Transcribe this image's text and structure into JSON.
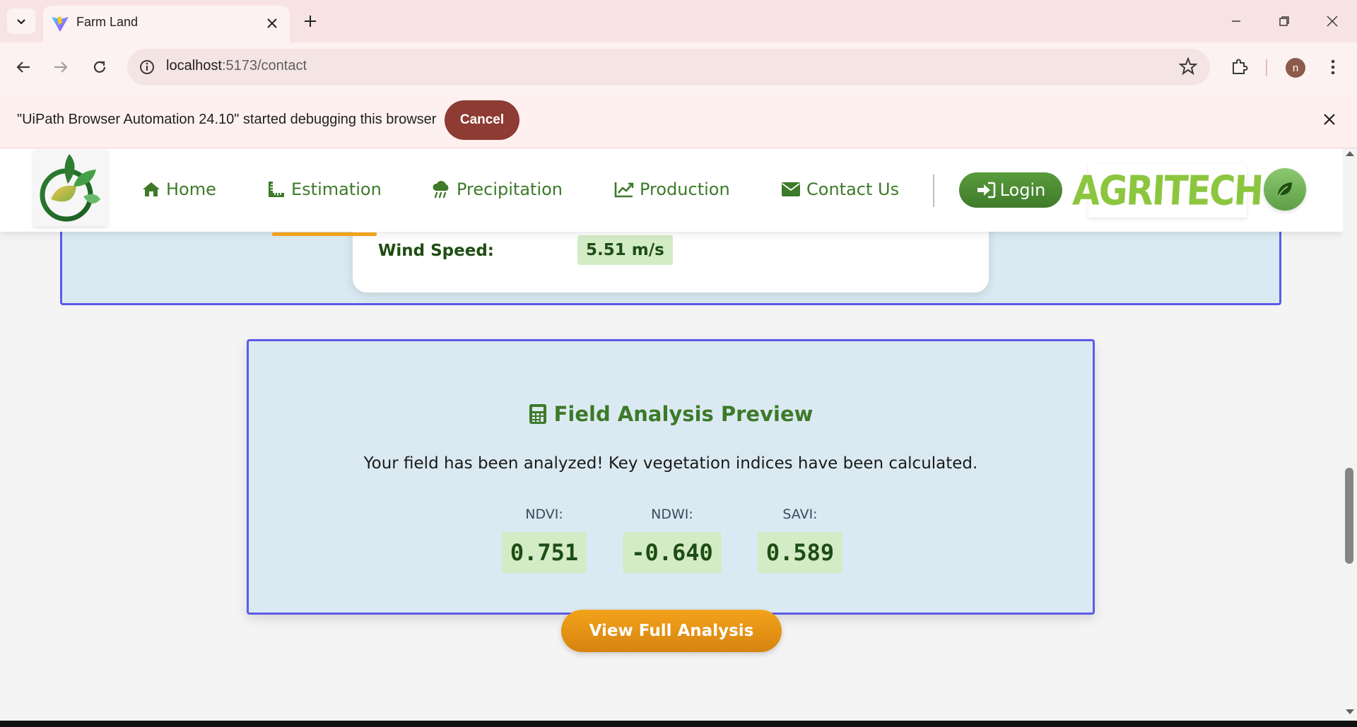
{
  "browser": {
    "tab_title": "Farm Land",
    "url_host": "localhost",
    "url_path": ":5173/contact",
    "profile_initial": "n"
  },
  "infobar": {
    "message": "\"UiPath Browser Automation 24.10\" started debugging this browser",
    "cancel_label": "Cancel"
  },
  "navbar": {
    "items": [
      {
        "label": "Home",
        "icon": "home-icon"
      },
      {
        "label": "Estimation",
        "icon": "ruler-icon"
      },
      {
        "label": "Precipitation",
        "icon": "cloud-rain-icon"
      },
      {
        "label": "Production",
        "icon": "chart-line-icon"
      },
      {
        "label": "Contact Us",
        "icon": "envelope-icon"
      }
    ],
    "login_label": "Login",
    "brand": "AGRITECH"
  },
  "weather": {
    "wind_label": "Wind Speed:",
    "wind_value": "5.51 m/s"
  },
  "analysis": {
    "title": "Field Analysis Preview",
    "description": "Your field has been analyzed! Key vegetation indices have been calculated.",
    "indices": [
      {
        "label": "NDVI:",
        "value": "0.751"
      },
      {
        "label": "NDWI:",
        "value": "-0.640"
      },
      {
        "label": "SAVI:",
        "value": "0.589"
      }
    ],
    "button_label": "View Full Analysis"
  },
  "colors": {
    "accent_green": "#3d7a2a",
    "accent_orange": "#f0a21b",
    "panel_border": "#5b5be8"
  }
}
